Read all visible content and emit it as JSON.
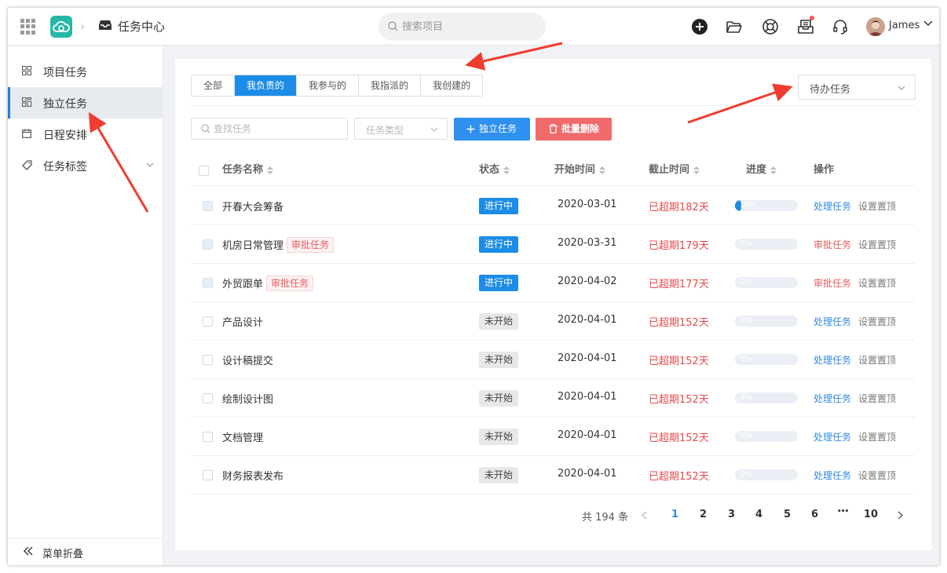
{
  "header": {
    "app_title": "任务中心",
    "search_placeholder": "搜索项目",
    "user_name": "James"
  },
  "sidebar": {
    "items": [
      {
        "label": "项目任务"
      },
      {
        "label": "独立任务"
      },
      {
        "label": "日程安排"
      },
      {
        "label": "任务标签"
      }
    ],
    "collapse_label": "菜单折叠"
  },
  "filter_tabs": [
    "全部",
    "我负责的",
    "我参与的",
    "我指派的",
    "我创建的"
  ],
  "active_tab": "我负责的",
  "task_filter": {
    "selected": "待办任务"
  },
  "toolbar": {
    "search_placeholder": "查找任务",
    "type_placeholder": "任务类型",
    "add_label": "独立任务",
    "delete_label": "批量删除"
  },
  "table": {
    "columns": [
      "任务名称",
      "状态",
      "开始时间",
      "截止时间",
      "进度",
      "操作"
    ],
    "rows": [
      {
        "name": "开春大会筹备",
        "tag": "",
        "status": "进行中",
        "start": "2020-03-01",
        "deadline": "已超期182天",
        "progress": "10%",
        "action": "处理任务",
        "action2": "设置置顶"
      },
      {
        "name": "机房日常管理",
        "tag": "审批任务",
        "status": "进行中",
        "start": "2020-03-31",
        "deadline": "已超期179天",
        "progress": "0%",
        "action": "审批任务",
        "action2": "设置置顶"
      },
      {
        "name": "外贸跟单",
        "tag": "审批任务",
        "status": "进行中",
        "start": "2020-04-02",
        "deadline": "已超期177天",
        "progress": "0%",
        "action": "审批任务",
        "action2": "设置置顶"
      },
      {
        "name": "产品设计",
        "tag": "",
        "status": "未开始",
        "start": "2020-04-01",
        "deadline": "已超期152天",
        "progress": "0%",
        "action": "处理任务",
        "action2": "设置置顶"
      },
      {
        "name": "设计稿提交",
        "tag": "",
        "status": "未开始",
        "start": "2020-04-01",
        "deadline": "已超期152天",
        "progress": "0%",
        "action": "处理任务",
        "action2": "设置置顶"
      },
      {
        "name": "绘制设计图",
        "tag": "",
        "status": "未开始",
        "start": "2020-04-01",
        "deadline": "已超期152天",
        "progress": "0%",
        "action": "处理任务",
        "action2": "设置置顶"
      },
      {
        "name": "文档管理",
        "tag": "",
        "status": "未开始",
        "start": "2020-04-01",
        "deadline": "已超期152天",
        "progress": "0%",
        "action": "处理任务",
        "action2": "设置置顶"
      },
      {
        "name": "财务报表发布",
        "tag": "",
        "status": "未开始",
        "start": "2020-04-01",
        "deadline": "已超期152天",
        "progress": "0%",
        "action": "处理任务",
        "action2": "设置置顶"
      }
    ]
  },
  "pagination": {
    "total_label": "共 194 条",
    "pages": [
      "1",
      "2",
      "3",
      "4",
      "5",
      "6",
      "10"
    ],
    "ellipsis": "•••",
    "current": "1"
  },
  "colors": {
    "primary": "#1c8ce6",
    "danger": "#f06a6a",
    "overdue_text": "#e84b4b",
    "logo": "#29b6a6",
    "annotation_arrow": "#f03c2f"
  }
}
